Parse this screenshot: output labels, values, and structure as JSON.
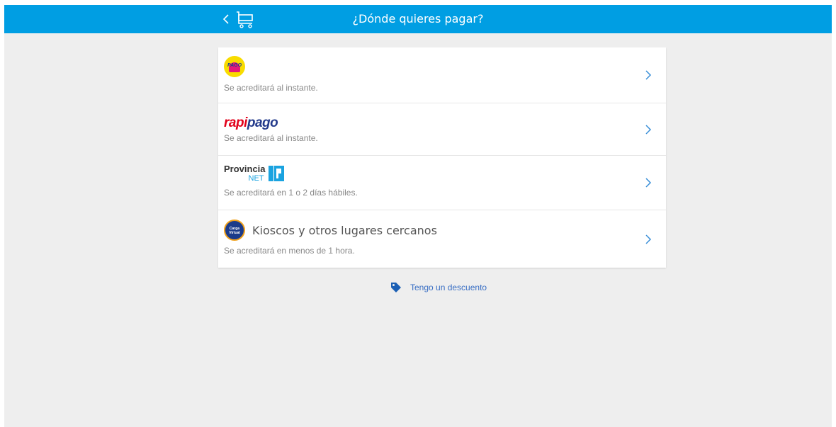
{
  "header": {
    "title": "¿Dónde quieres pagar?",
    "back_icon": "chevron-left-icon",
    "cart_icon": "cart-icon",
    "color": "#009ee3"
  },
  "options": [
    {
      "logo": "pago-facil-logo",
      "logo_text": "PAGO",
      "subtitle": "Se acreditará al instante."
    },
    {
      "logo": "rapipago-logo",
      "brand_a": "rapi",
      "brand_b": "pago",
      "subtitle": "Se acreditará al instante."
    },
    {
      "logo": "provincia-net-logo",
      "brand_top": "Provincia",
      "brand_bottom": "NET",
      "subtitle": "Se acreditará en 1 o 2 días hábiles."
    },
    {
      "logo": "carga-virtual-logo",
      "logo_text": "Carga Virtual",
      "label": "Kioscos y otros lugares cercanos",
      "subtitle": "Se acreditará en menos de 1 hora."
    }
  ],
  "discount": {
    "label": "Tengo un descuento",
    "icon": "tag-icon",
    "color": "#3a6fc4"
  }
}
